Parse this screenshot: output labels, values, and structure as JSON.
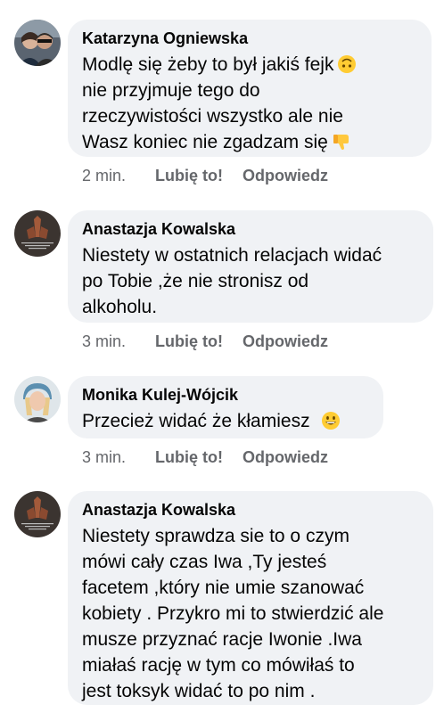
{
  "comments": [
    {
      "author": "Katarzyna Ogniewska",
      "lines": [
        "Modlę się żeby to był jakiś fejk",
        "nie przyjmuje tego do",
        "rzeczywistości wszystko ale nie",
        "Wasz koniec nie zgadzam się"
      ],
      "emojis": [
        "upside-down-face-emoji",
        "thumbs-down-emoji"
      ],
      "time": "2 min.",
      "like_label": "Lubię to!",
      "reply_label": "Odpowiedz"
    },
    {
      "author": "Anastazja Kowalska",
      "lines": [
        "Niestety w ostatnich relacjach widać",
        "po Tobie ,że nie stronisz od",
        "alkoholu."
      ],
      "time": "3 min.",
      "like_label": "Lubię to!",
      "reply_label": "Odpowiedz"
    },
    {
      "author": "Monika Kulej-Wójcik",
      "lines": [
        "Przecież widać że kłamiesz"
      ],
      "emojis": [
        "grinning-face-emoji"
      ],
      "time": "3 min.",
      "like_label": "Lubię to!",
      "reply_label": "Odpowiedz"
    },
    {
      "author": "Anastazja Kowalska",
      "lines": [
        "Niestety sprawdza sie to o czym",
        "mówi cały czas Iwa ,Ty jesteś",
        "facetem ,który nie umie szanować",
        "kobiety . Przykro mi to stwierdzić ale",
        "musze przyznać racje Iwonie .Iwa",
        "miałaś rację w tym co mówiłaś to",
        "jest toksyk widać to po nim ."
      ]
    }
  ],
  "colors": {
    "bubble": "#f0f2f5",
    "text": "#050505",
    "meta": "#65676b"
  }
}
